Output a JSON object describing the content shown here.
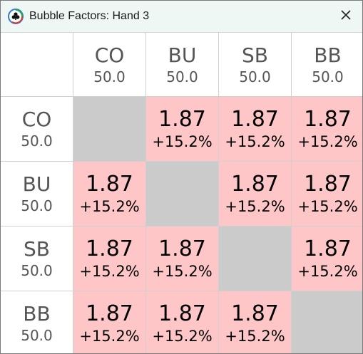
{
  "window": {
    "title": "Bubble Factors: Hand 3",
    "app_icon": "club-suit-icon",
    "close_icon": "close-icon"
  },
  "colors": {
    "titlebar_bg": "#eef7f4",
    "cell_bg": "#ffc6c8",
    "diagonal_bg": "#cbcbcb",
    "grid_line": "#d0d0d0"
  },
  "columns": [
    {
      "name": "CO",
      "stack": "50.0"
    },
    {
      "name": "BU",
      "stack": "50.0"
    },
    {
      "name": "SB",
      "stack": "50.0"
    },
    {
      "name": "BB",
      "stack": "50.0"
    }
  ],
  "rows": [
    {
      "name": "CO",
      "stack": "50.0",
      "cells": [
        null,
        {
          "value": "1.87",
          "pct": "+15.2%"
        },
        {
          "value": "1.87",
          "pct": "+15.2%"
        },
        {
          "value": "1.87",
          "pct": "+15.2%"
        }
      ]
    },
    {
      "name": "BU",
      "stack": "50.0",
      "cells": [
        {
          "value": "1.87",
          "pct": "+15.2%"
        },
        null,
        {
          "value": "1.87",
          "pct": "+15.2%"
        },
        {
          "value": "1.87",
          "pct": "+15.2%"
        }
      ]
    },
    {
      "name": "SB",
      "stack": "50.0",
      "cells": [
        {
          "value": "1.87",
          "pct": "+15.2%"
        },
        {
          "value": "1.87",
          "pct": "+15.2%"
        },
        null,
        {
          "value": "1.87",
          "pct": "+15.2%"
        }
      ]
    },
    {
      "name": "BB",
      "stack": "50.0",
      "cells": [
        {
          "value": "1.87",
          "pct": "+15.2%"
        },
        {
          "value": "1.87",
          "pct": "+15.2%"
        },
        {
          "value": "1.87",
          "pct": "+15.2%"
        },
        null
      ]
    }
  ]
}
